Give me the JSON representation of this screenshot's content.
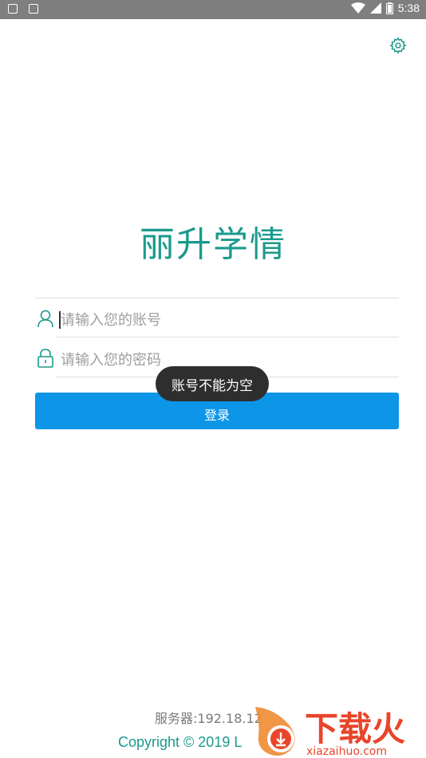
{
  "status_bar": {
    "time": "5:38",
    "icons": [
      "notification-icon",
      "app-a-icon",
      "wifi-icon",
      "signal-icon",
      "battery-icon"
    ]
  },
  "header": {
    "settings_icon": "gear-icon"
  },
  "app": {
    "title": "丽升学情"
  },
  "form": {
    "account_placeholder": "请输入您的账号",
    "account_value": "",
    "password_placeholder": "请输入您的密码",
    "password_value": "",
    "login_label": "登录"
  },
  "toast": {
    "message": "账号不能为空"
  },
  "footer": {
    "server": "服务器:192.18.12",
    "copyright": "Copyright © 2019 L"
  },
  "watermark": {
    "brand": "下载火",
    "domain": "xiazaihuo.com"
  },
  "colors": {
    "accent": "#1a9a8c",
    "button": "#0d95e8",
    "toast_bg": "#2e2e2e",
    "status_bar": "#7f7f7f",
    "watermark": "#e8452a"
  }
}
